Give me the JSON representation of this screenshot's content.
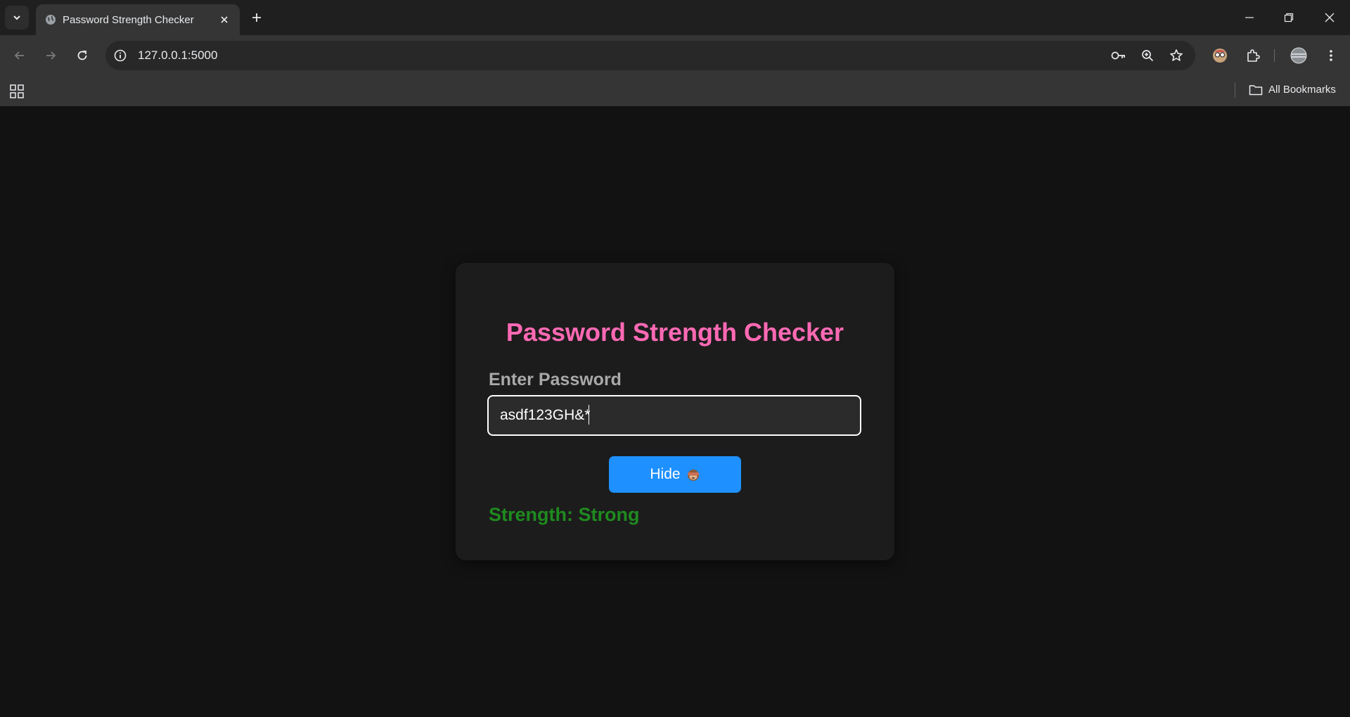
{
  "browser": {
    "tab_title": "Password Strength Checker",
    "url": "127.0.0.1:5000",
    "bookmarks_label": "All Bookmarks",
    "icons": [
      "tab-search-icon",
      "globe-icon",
      "close-icon",
      "plus-icon",
      "minimize-icon",
      "restore-icon",
      "window-close-icon",
      "back-arrow-icon",
      "forward-arrow-icon",
      "reload-icon",
      "site-info-icon",
      "key-icon",
      "zoom-icon",
      "star-icon",
      "extension-avatar-icon",
      "puzzle-icon",
      "profile-avatar-icon",
      "kebab-menu-icon",
      "apps-grid-icon",
      "folder-icon"
    ]
  },
  "app": {
    "title": "Password Strength Checker",
    "input_label": "Enter Password",
    "password_value": "asdf123GH&*",
    "toggle_button_label": "Hide",
    "toggle_button_icon": "see-no-evil-monkey-icon",
    "strength_text": "Strength: Strong",
    "colors": {
      "title": "#ff69b4",
      "button": "#1e90ff",
      "strength": "#1f8a1f",
      "card": "#1c1c1c",
      "page": "#121212"
    }
  }
}
